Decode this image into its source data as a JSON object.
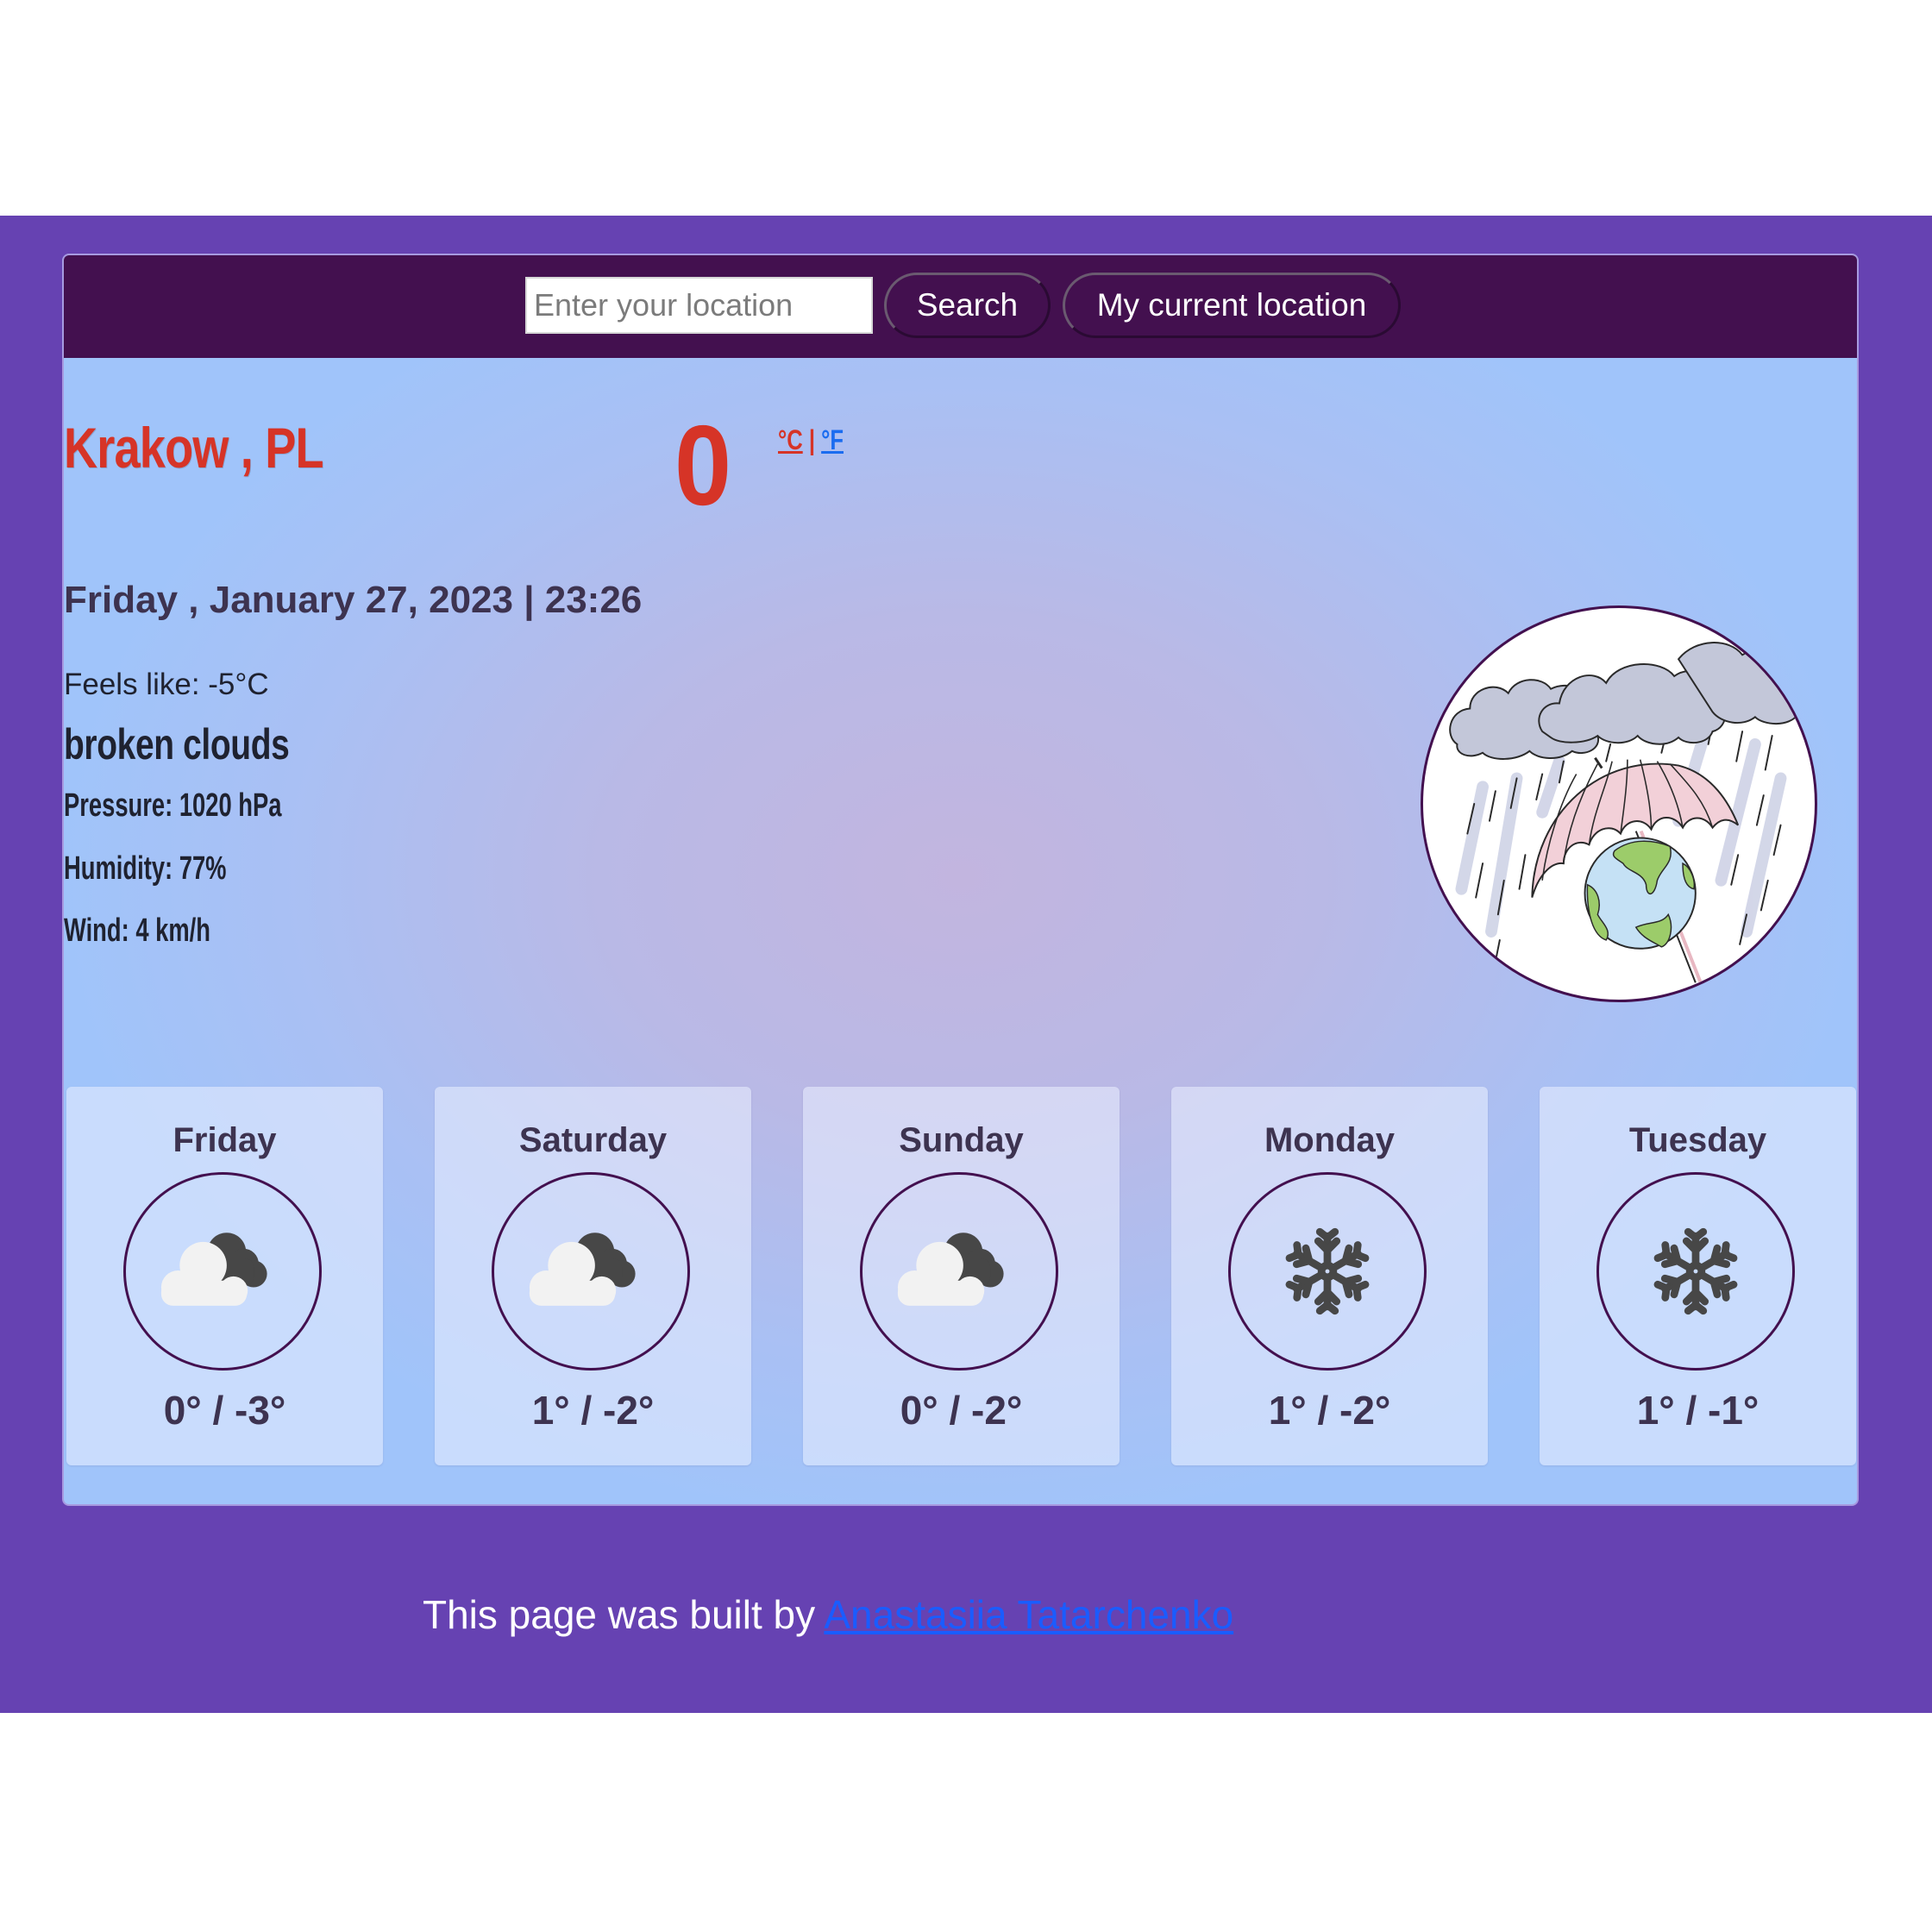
{
  "search": {
    "placeholder": "Enter your location",
    "value": "",
    "search_label": "Search",
    "current_location_label": "My current location"
  },
  "current": {
    "city": "Krakow , PL",
    "temperature": "0",
    "unit_celsius": "°C",
    "unit_separator": "|",
    "unit_fahrenheit": "°F",
    "active_unit": "celsius",
    "datetime": "Friday , January 27, 2023 | 23:26",
    "feels_like": "Feels like: -5°C",
    "description": "broken clouds",
    "pressure": "Pressure: 1020 hPa",
    "humidity": "Humidity: 77%",
    "wind": "Wind: 4 km/h",
    "illustration": "rain-umbrella-earth-illustration"
  },
  "forecast": [
    {
      "day": "Friday",
      "icon": "broken-clouds-icon",
      "temps": "0° / -3°",
      "max": 0,
      "min": -3
    },
    {
      "day": "Saturday",
      "icon": "broken-clouds-icon",
      "temps": "1° / -2°",
      "max": 1,
      "min": -2
    },
    {
      "day": "Sunday",
      "icon": "broken-clouds-icon",
      "temps": "0° / -2°",
      "max": 0,
      "min": -2
    },
    {
      "day": "Monday",
      "icon": "snowflake-icon",
      "temps": "1° / -2°",
      "max": 1,
      "min": -2
    },
    {
      "day": "Tuesday",
      "icon": "snowflake-icon",
      "temps": "1° / -1°",
      "max": 1,
      "min": -1
    }
  ],
  "footer": {
    "text": "This page was built by ",
    "author_link": "Anastasiia Tatarchenko"
  },
  "colors": {
    "page_band": "#6642b2",
    "header_bar": "#43104f",
    "accent_red": "#d63427",
    "link_blue": "#1a6cf0",
    "text_dark": "#3d3350"
  }
}
